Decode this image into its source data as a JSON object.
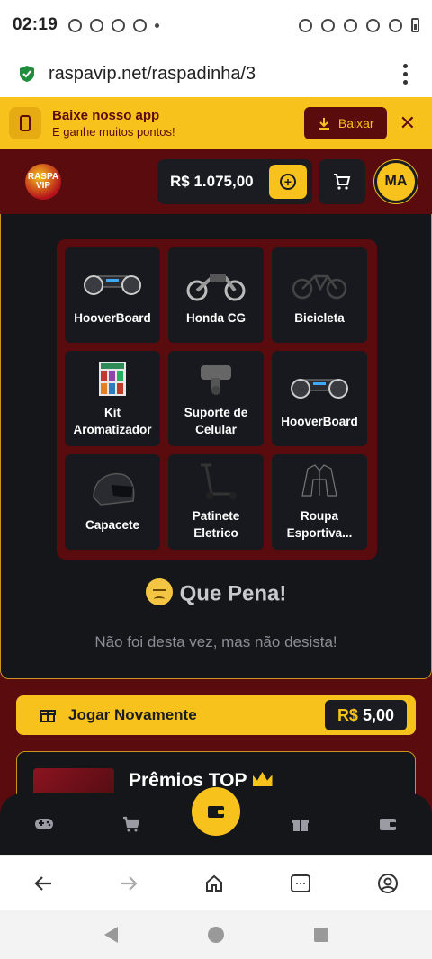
{
  "status": {
    "time": "02:19"
  },
  "browser": {
    "url": "raspavip.net/raspadinha/3"
  },
  "app_banner": {
    "title": "Baixe nosso app",
    "subtitle": "E ganhe muitos pontos!",
    "download_label": "Baixar",
    "close_label": "✕"
  },
  "header": {
    "logo_text": "RASPA VIP",
    "balance": "R$ 1.075,00",
    "avatar_initials": "MA"
  },
  "scratch_grid": {
    "items": [
      {
        "label": "HooverBoard",
        "icon": "hoverboard-icon"
      },
      {
        "label": "Honda CG",
        "icon": "motorcycle-icon"
      },
      {
        "label": "Bicicleta",
        "icon": "bicycle-icon"
      },
      {
        "label": "Kit Aromatizador",
        "icon": "aroma-kit-icon"
      },
      {
        "label": "Suporte de Celular",
        "icon": "phone-holder-icon"
      },
      {
        "label": "HooverBoard",
        "icon": "hoverboard-icon"
      },
      {
        "label": "Capacete",
        "icon": "helmet-icon"
      },
      {
        "label": "Patinete Eletrico",
        "icon": "scooter-icon"
      },
      {
        "label": "Roupa Esportiva...",
        "icon": "jacket-icon"
      }
    ]
  },
  "result": {
    "title": "Que Pena!",
    "subtitle": "Não foi desta vez, mas não desista!"
  },
  "play_again": {
    "label": "Jogar Novamente",
    "currency": "R$",
    "price": "5,00"
  },
  "top_prizes": {
    "title": "Prêmios TOP"
  },
  "colors": {
    "accent": "#f7c21c",
    "brand_dark_red": "#5a0b0e",
    "panel": "#15161a",
    "border_gold": "#c8961e"
  }
}
